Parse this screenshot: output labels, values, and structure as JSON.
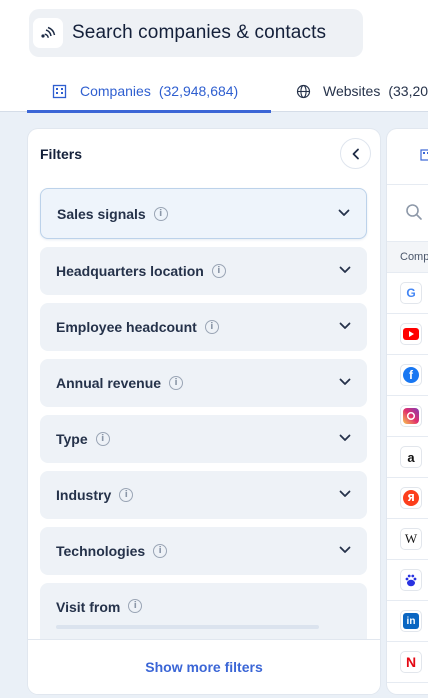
{
  "search": {
    "label": "Search companies & contacts",
    "icon": "voice-search-icon"
  },
  "tabs": [
    {
      "label": "Companies",
      "count": "(32,948,684)",
      "icon": "building-icon",
      "active": true
    },
    {
      "label": "Websites",
      "count": "(33,20",
      "icon": "globe-icon",
      "active": false
    }
  ],
  "filters": {
    "title": "Filters",
    "items": [
      {
        "label": "Sales signals"
      },
      {
        "label": "Headquarters location"
      },
      {
        "label": "Employee headcount"
      },
      {
        "label": "Annual revenue"
      },
      {
        "label": "Type"
      },
      {
        "label": "Industry"
      },
      {
        "label": "Technologies"
      },
      {
        "label": "Visit from"
      }
    ],
    "info_glyph": "i",
    "show_more": "Show more filters"
  },
  "results": {
    "column_header": "Comp",
    "logos": [
      "google-logo",
      "youtube-logo",
      "facebook-logo",
      "instagram-logo",
      "amazon-logo",
      "yandex-logo",
      "wikipedia-logo",
      "baidu-logo",
      "linkedin-logo",
      "netflix-logo"
    ],
    "logo_glyphs": {
      "google": "G",
      "yandex": "Я",
      "wikipedia": "W",
      "linkedin": "in",
      "netflix": "N",
      "facebook": "f",
      "amazon": "a"
    }
  },
  "colors": {
    "accent": "#3b66d6",
    "background": "#eaf0f7",
    "filter_bg": "#eef2f7"
  }
}
